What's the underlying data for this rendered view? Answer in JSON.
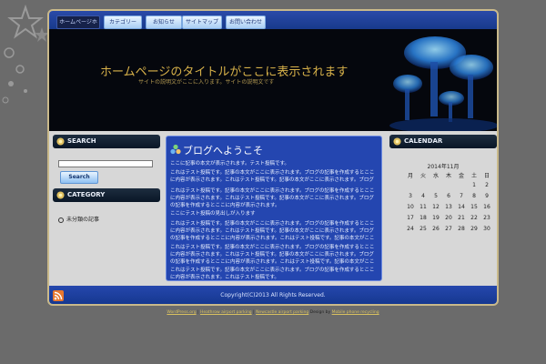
{
  "nav": {
    "tabs": [
      {
        "label": "ホームページホーム"
      },
      {
        "label": "カテゴリー"
      },
      {
        "label": "お知らせ"
      },
      {
        "label": "サイトマップ"
      },
      {
        "label": "お問い合わせ"
      }
    ]
  },
  "header": {
    "title": "ホームページのタイトルがここに表示されます",
    "description": "サイトの説明文がここに入ります。サイトの説明文です"
  },
  "sidebar_left": {
    "search": {
      "heading": "SEARCH",
      "input_value": "",
      "button_label": "Search"
    },
    "category": {
      "heading": "CATEGORY",
      "items": [
        "未分類の記事"
      ]
    }
  },
  "post": {
    "title": "ブログへようこそ",
    "paragraphs": [
      "ここに記事の本文が表示されます。テスト投稿です。",
      "これはテスト投稿です。記事の本文がここに表示されます。ブログの記事を作成するとここに内容が表示されます。これはテスト投稿です。記事の本文がここに表示されます。ブログの記事を作成するとここに内容が表示されます。",
      "これはテスト投稿です。記事の本文がここに表示されます。ブログの記事を作成するとここに内容が表示されます。これはテスト投稿です。記事の本文がここに表示されます。ブログの記事を作成するとここに内容が表示されます。",
      "ここにテスト投稿の見出しが入ります",
      "これはテスト投稿です。記事の本文がここに表示されます。ブログの記事を作成するとここに内容が表示されます。これはテスト投稿です。記事の本文がここに表示されます。ブログの記事を作成するとここに内容が表示されます。これはテスト投稿です。記事の本文がここに表示されます。",
      "これはテスト投稿です。記事の本文がここに表示されます。ブログの記事を作成するとここに内容が表示されます。これはテスト投稿です。記事の本文がここに表示されます。ブログの記事を作成するとここに内容が表示されます。これはテスト投稿です。記事の本文がここに表示されます。",
      "これはテスト投稿です。記事の本文がここに表示されます。ブログの記事を作成するとここに内容が表示されます。これはテスト投稿です。"
    ]
  },
  "sidebar_right": {
    "calendar": {
      "heading": "CALENDAR",
      "caption": "2014年11月",
      "weekdays": [
        "月",
        "火",
        "水",
        "木",
        "金",
        "土",
        "日"
      ],
      "rows": [
        [
          "",
          "",
          "",
          "",
          "",
          "1",
          "2"
        ],
        [
          "3",
          "4",
          "5",
          "6",
          "7",
          "8",
          "9"
        ],
        [
          "10",
          "11",
          "12",
          "13",
          "14",
          "15",
          "16"
        ],
        [
          "17",
          "18",
          "19",
          "20",
          "21",
          "22",
          "23"
        ],
        [
          "24",
          "25",
          "26",
          "27",
          "28",
          "29",
          "30"
        ]
      ]
    }
  },
  "footer": {
    "copyright": "Copyright(C)2013 All Rights Reserved."
  },
  "credits": {
    "link1": "WordPress.org",
    "sep1": " | ",
    "link2": "Heathrow airport parking",
    "sep2": " | ",
    "link3": "Newcastle airport parking",
    "mid": " Design by ",
    "link4": "Mobile phone recycling"
  },
  "colors": {
    "accent": "#2446b0",
    "title_gold": "#d8b24a",
    "background": "#6b6b6b"
  }
}
